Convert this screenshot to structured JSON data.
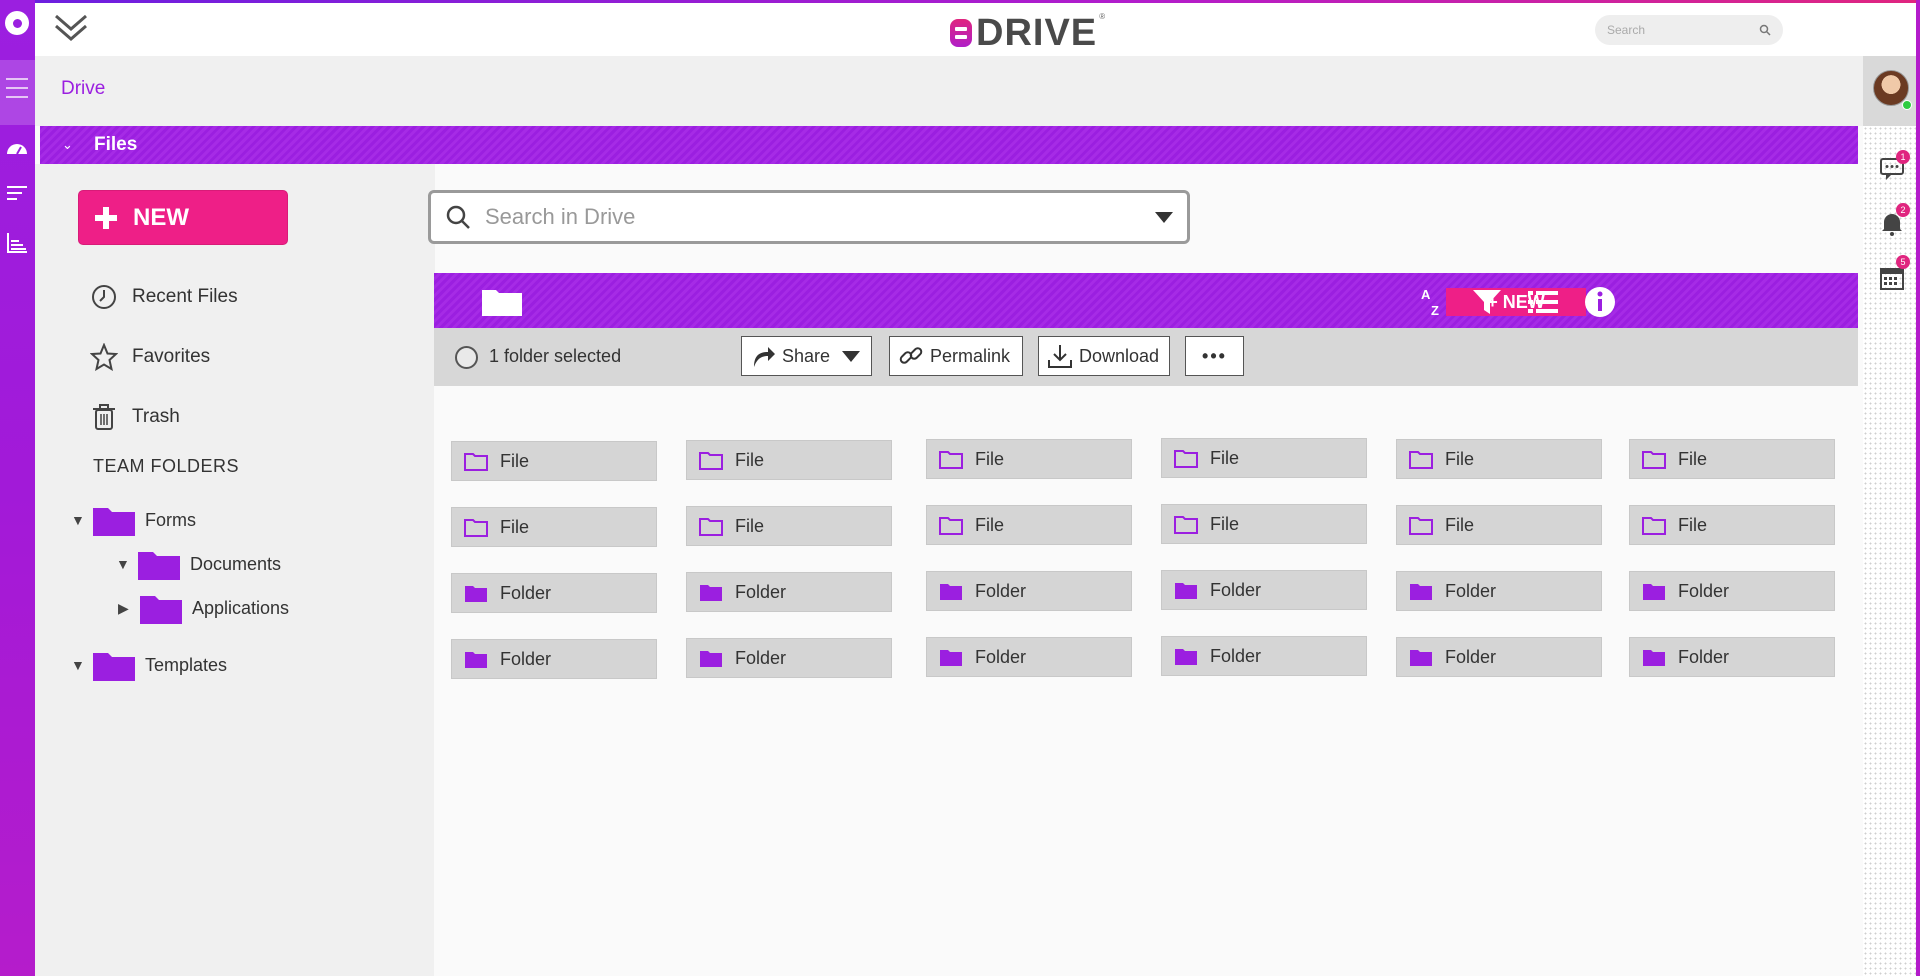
{
  "app": {
    "brand": "DRIVE",
    "reg_mark": "®"
  },
  "topbar": {
    "search_placeholder": "Search"
  },
  "breadcrumb": {
    "label": "Drive"
  },
  "section": {
    "title": "Files"
  },
  "sidebar": {
    "new_label": "NEW",
    "nav": [
      {
        "label": "Recent Files",
        "icon": "clock-icon"
      },
      {
        "label": "Favorites",
        "icon": "star-icon"
      },
      {
        "label": "Trash",
        "icon": "trash-icon"
      }
    ],
    "team_heading": "TEAM FOLDERS",
    "tree": [
      {
        "label": "Forms",
        "expanded": true
      },
      {
        "label": "Documents",
        "expanded": true
      },
      {
        "label": "Applications",
        "expanded": false
      },
      {
        "label": "Templates",
        "expanded": true
      }
    ]
  },
  "main": {
    "search_placeholder": "Search in Drive",
    "toolbar": {
      "new_label": "+ NEW"
    },
    "selection": {
      "text": "1 folder selected"
    },
    "actions": {
      "share": "Share",
      "permalink": "Permalink",
      "download": "Download",
      "more": "•••"
    },
    "rows": [
      [
        "File",
        "File",
        "File",
        "File",
        "File",
        "File"
      ],
      [
        "File",
        "File",
        "File",
        "File",
        "File",
        "File"
      ],
      [
        "Folder",
        "Folder",
        "Folder",
        "Folder",
        "Folder",
        "Folder"
      ],
      [
        "Folder",
        "Folder",
        "Folder",
        "Folder",
        "Folder",
        "Folder"
      ]
    ]
  },
  "right_rail": {
    "badges": {
      "chat": "1",
      "notifications": "2",
      "calendar": "5"
    }
  },
  "colors": {
    "accent": "#9b1fe0",
    "brand_pink": "#ee1f87",
    "status_online": "#2ecc40"
  }
}
